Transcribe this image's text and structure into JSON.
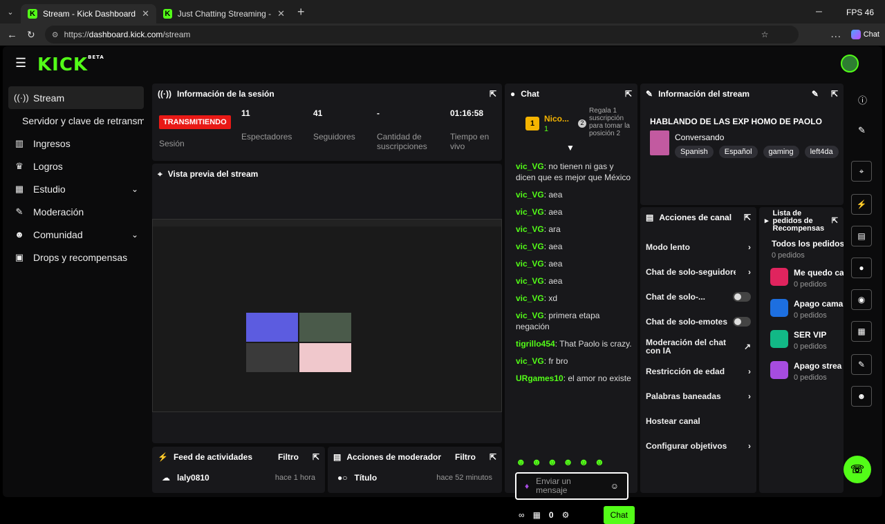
{
  "browser": {
    "tabs": [
      {
        "label": "Stream - Kick Dashboard"
      },
      {
        "label": "Just Chatting Streaming - Live Stre"
      }
    ],
    "url_prefix": "https://",
    "url_host": "dashboard.kick.com",
    "url_path": "/stream",
    "fps": "FPS 46",
    "copilot_label": "Chat"
  },
  "brand": {
    "logo": "KICK",
    "beta": "BETA"
  },
  "sidebar": {
    "items": [
      {
        "label": "Stream"
      },
      {
        "label": "Servidor y clave de retransm"
      },
      {
        "label": "Ingresos"
      },
      {
        "label": "Logros"
      },
      {
        "label": "Estudio"
      },
      {
        "label": "Moderación"
      },
      {
        "label": "Comunidad"
      },
      {
        "label": "Drops y recompensas"
      }
    ]
  },
  "session": {
    "title": "Información de la sesión",
    "status": "TRANSMITIENDO",
    "status_label": "Sesión",
    "stats": [
      {
        "value": "11",
        "label": "Espectadores"
      },
      {
        "value": "41",
        "label": "Seguidores"
      },
      {
        "value": "-",
        "label": "Cantidad de suscripciones"
      },
      {
        "value": "01:16:58",
        "label": "Tiempo en vivo"
      }
    ]
  },
  "preview": {
    "title": "Vista previa del stream"
  },
  "activity": {
    "title": "Feed de actividades",
    "filter": "Filtro",
    "user": "laly0810",
    "time": "hace 1 hora"
  },
  "modactions": {
    "title": "Acciones de moderador",
    "filter": "Filtro",
    "item": "Título",
    "time": "hace 52 minutos"
  },
  "chat": {
    "title": "Chat",
    "pinned_user": "Nico...",
    "pinned_rank": "1",
    "pinned_count": "1",
    "gift_rank": "2",
    "gift_text": "Regala 1 suscripción para tomar la posición 2",
    "messages": [
      {
        "user": "vic_VG",
        "text": "no tienen ni gas y dicen que es mejor que México"
      },
      {
        "user": "vic_VG",
        "text": "aea"
      },
      {
        "user": "vic_VG",
        "text": "aea"
      },
      {
        "user": "vic_VG",
        "text": "ara"
      },
      {
        "user": "vic_VG",
        "text": "aea"
      },
      {
        "user": "vic_VG",
        "text": "aea"
      },
      {
        "user": "vic_VG",
        "text": "aea"
      },
      {
        "user": "vic_VG",
        "text": "xd"
      },
      {
        "user": "vic_VG",
        "text": "primera etapa negación"
      },
      {
        "user": "tigrillo454",
        "text": "That Paolo is crazy."
      },
      {
        "user": "vic_VG",
        "text": "fr bro"
      },
      {
        "user": "URgames10",
        "text": "el amor no existe"
      }
    ],
    "input_placeholder": "Enviar un mensaje",
    "points": "0",
    "send": "Chat"
  },
  "streaminfo": {
    "title": "Información del stream",
    "stream_title": "HABLANDO DE LAS EXP HOMO DE PAOLO",
    "category": "Conversando",
    "tags": [
      "Spanish",
      "Español",
      "gaming",
      "left4da"
    ]
  },
  "channel": {
    "title": "Acciones de canal",
    "items": [
      {
        "label": "Modo lento",
        "kind": "arrow"
      },
      {
        "label": "Chat de solo-seguidore",
        "kind": "arrow"
      },
      {
        "label": "Chat de solo-...",
        "kind": "toggle"
      },
      {
        "label": "Chat de solo-emotes",
        "kind": "toggle"
      },
      {
        "label": "Moderación del chat con IA",
        "kind": "link"
      },
      {
        "label": "Restricción de edad",
        "kind": "arrow"
      },
      {
        "label": "Palabras baneadas",
        "kind": "arrow"
      },
      {
        "label": "Hostear canal",
        "kind": "none"
      },
      {
        "label": "Configurar objetivos",
        "kind": "arrow"
      }
    ]
  },
  "rewards": {
    "title": "Lista de pedidos de Recompensas",
    "all": "Todos los pedidos",
    "all_count": "0 pedidos",
    "items": [
      {
        "name": "Me quedo ca",
        "count": "0 pedidos",
        "color": "#e0245e"
      },
      {
        "name": "Apago cama",
        "count": "0 pedidos",
        "color": "#1d6fe0"
      },
      {
        "name": "SER VIP",
        "count": "0 pedidos",
        "color": "#12b886"
      },
      {
        "name": "Apago strea",
        "count": "0 pedidos",
        "color": "#a64ce0"
      }
    ]
  },
  "colors": {
    "accent": "#53fc18",
    "live": "#e91916"
  }
}
